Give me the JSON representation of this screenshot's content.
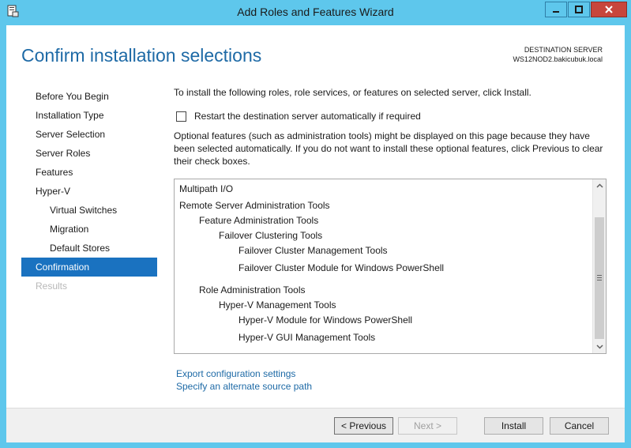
{
  "window": {
    "title": "Add Roles and Features Wizard",
    "minimize_glyph": "▬",
    "maximize_glyph": "□",
    "close_glyph": "✕"
  },
  "header": {
    "page_title": "Confirm installation selections",
    "destination_label": "DESTINATION SERVER",
    "destination_server": "WS12NOD2.bakicubuk.local"
  },
  "sidebar": {
    "items": [
      {
        "label": "Before You Begin"
      },
      {
        "label": "Installation Type"
      },
      {
        "label": "Server Selection"
      },
      {
        "label": "Server Roles"
      },
      {
        "label": "Features"
      },
      {
        "label": "Hyper-V"
      },
      {
        "label": "Virtual Switches"
      },
      {
        "label": "Migration"
      },
      {
        "label": "Default Stores"
      },
      {
        "label": "Confirmation"
      },
      {
        "label": "Results"
      }
    ]
  },
  "main": {
    "intro": "To install the following roles, role services, or features on selected server, click Install.",
    "restart_label": "Restart the destination server automatically if required",
    "optional_note": "Optional features (such as administration tools) might be displayed on this page because they have been selected automatically. If you do not want to install these optional features, click Previous to clear their check boxes.",
    "features": [
      {
        "label": "Multipath I/O"
      },
      {
        "label": "Remote Server Administration Tools"
      },
      {
        "label": "Feature Administration Tools"
      },
      {
        "label": "Failover Clustering Tools"
      },
      {
        "label": "Failover Cluster Management Tools"
      },
      {
        "label": "Failover Cluster Module for Windows PowerShell"
      },
      {
        "label": "Role Administration Tools"
      },
      {
        "label": "Hyper-V Management Tools"
      },
      {
        "label": "Hyper-V Module for Windows PowerShell"
      },
      {
        "label": "Hyper-V GUI Management Tools"
      }
    ],
    "export_link": "Export configuration settings",
    "alternate_link": "Specify an alternate source path"
  },
  "footer": {
    "previous_label": "< Previous",
    "next_label": "Next >",
    "install_label": "Install",
    "cancel_label": "Cancel"
  },
  "colors": {
    "frame": "#5ec7ec",
    "accent": "#1e6aa6",
    "selected": "#1a72c0",
    "close": "#c7463c"
  }
}
